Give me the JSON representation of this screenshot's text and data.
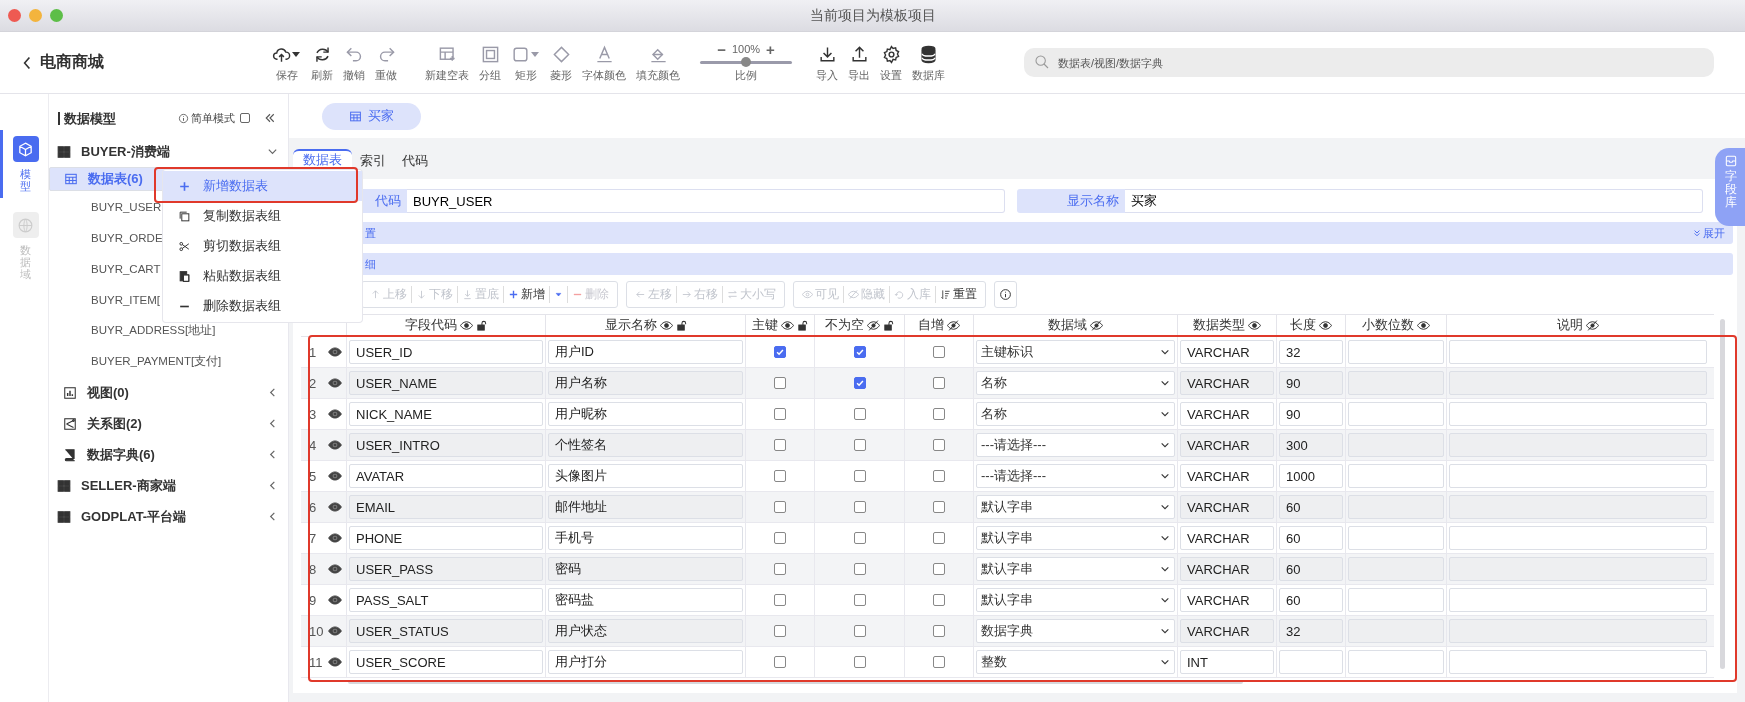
{
  "window": {
    "title": "当前项目为模板项目"
  },
  "header": {
    "back_label": "电商商城"
  },
  "toolbar": [
    {
      "label": "保存",
      "disabled": false,
      "dropdown": true
    },
    {
      "label": "刷新",
      "disabled": false,
      "dropdown": false
    },
    {
      "label": "撤销",
      "disabled": true,
      "dropdown": false
    },
    {
      "label": "重做",
      "disabled": true,
      "dropdown": false
    },
    {
      "label": "新建空表",
      "disabled": true,
      "dropdown": false
    },
    {
      "label": "分组",
      "disabled": true,
      "dropdown": false
    },
    {
      "label": "矩形",
      "disabled": true,
      "dropdown": true
    },
    {
      "label": "菱形",
      "disabled": true,
      "dropdown": false
    },
    {
      "label": "字体颜色",
      "disabled": true,
      "dropdown": false
    },
    {
      "label": "填充颜色",
      "disabled": true,
      "dropdown": false
    }
  ],
  "zoom": {
    "decrease": "−",
    "value": "100%",
    "increase": "+",
    "level": 0.5,
    "label": "比例"
  },
  "toolbar_right": [
    {
      "label": "导入"
    },
    {
      "label": "导出"
    },
    {
      "label": "设置"
    },
    {
      "label": "数据库"
    }
  ],
  "search": {
    "placeholder": "数据表/视图/数据字典"
  },
  "rail": [
    {
      "label": "模型",
      "selected": true
    },
    {
      "label": "数据域",
      "selected": false
    }
  ],
  "sidebar": {
    "title": "数据模型",
    "simple_mode": {
      "label": "简单模式",
      "checked": false
    },
    "tree": [
      {
        "label": "BUYER-消费端",
        "kind": "group",
        "expanded": true,
        "selected": false,
        "children": [
          {
            "label": "数据表(6)",
            "kind": "tables",
            "expanded": true,
            "selected": true,
            "children": [
              {
                "label": "BUYR_USER",
                "kind": "table",
                "selected": false
              },
              {
                "label": "BUYR_ORDE",
                "kind": "table",
                "selected": false
              },
              {
                "label": "BUYR_CART",
                "kind": "table",
                "selected": false
              },
              {
                "label": "BUYR_ITEM[",
                "kind": "table",
                "selected": false
              },
              {
                "label": "BUYR_ADDRESS[地址]",
                "kind": "table",
                "selected": false
              },
              {
                "label": "BUYER_PAYMENT[支付]",
                "kind": "table",
                "selected": false
              }
            ]
          },
          {
            "label": "视图(0)",
            "kind": "views",
            "expanded": false,
            "selected": false
          },
          {
            "label": "关系图(2)",
            "kind": "diagram",
            "expanded": false,
            "selected": false
          },
          {
            "label": "数据字典(6)",
            "kind": "dictionary",
            "expanded": false,
            "selected": false
          }
        ]
      },
      {
        "label": "SELLER-商家端",
        "kind": "group",
        "expanded": false,
        "selected": false
      },
      {
        "label": "GODPLAT-平台端",
        "kind": "group",
        "expanded": false,
        "selected": false
      }
    ]
  },
  "context_menu": [
    {
      "label": "新增数据表",
      "selected": true
    },
    {
      "label": "复制数据表组",
      "selected": false
    },
    {
      "label": "剪切数据表组",
      "selected": false
    },
    {
      "label": "粘贴数据表组",
      "selected": false
    },
    {
      "label": "删除数据表组",
      "selected": false
    }
  ],
  "doc_tabs": [
    {
      "label": "买家",
      "selected": true
    }
  ],
  "side_tab": {
    "label": "字段库"
  },
  "panel_tabs": [
    {
      "label": "数据表",
      "selected": true
    },
    {
      "label": "索引",
      "selected": false
    },
    {
      "label": "代码",
      "selected": false
    }
  ],
  "form": [
    {
      "label": "代码",
      "value": "BUYR_USER"
    },
    {
      "label": "显示名称",
      "value": "买家"
    }
  ],
  "sections": [
    {
      "label": "置",
      "toggle": "展开"
    },
    {
      "label": "细"
    }
  ],
  "table_toolbar": [
    [
      {
        "kind": "button",
        "label": "上移",
        "disabled": true
      },
      {
        "kind": "button",
        "label": "下移",
        "disabled": true
      },
      {
        "kind": "button",
        "label": "置底",
        "disabled": true
      },
      {
        "kind": "button",
        "label": "新增",
        "disabled": false
      },
      {
        "kind": "caret",
        "disabled": false
      },
      {
        "kind": "button",
        "label": "删除",
        "disabled": true
      }
    ],
    [
      {
        "kind": "button",
        "label": "左移",
        "disabled": true
      },
      {
        "kind": "button",
        "label": "右移",
        "disabled": true
      },
      {
        "kind": "button",
        "label": "大小写",
        "disabled": true
      }
    ],
    [
      {
        "kind": "button",
        "label": "可见",
        "disabled": true
      },
      {
        "kind": "button",
        "label": "隐藏",
        "disabled": true
      },
      {
        "kind": "button",
        "label": "入库",
        "disabled": true
      },
      {
        "kind": "button",
        "label": "重置",
        "disabled": false
      }
    ],
    [
      {
        "kind": "info",
        "disabled": false
      }
    ]
  ],
  "table": {
    "columns": [
      {
        "label": "字段代码",
        "visible": true,
        "lock": true
      },
      {
        "label": "显示名称",
        "visible": true,
        "lock": true
      },
      {
        "label": "主键",
        "visible": true,
        "lock": true
      },
      {
        "label": "不为空",
        "visible": false,
        "lock": true
      },
      {
        "label": "自增",
        "visible": false,
        "lock": false
      },
      {
        "label": "数据域",
        "visible": false,
        "lock": false
      },
      {
        "label": "数据类型",
        "visible": true,
        "lock": false
      },
      {
        "label": "长度",
        "visible": true,
        "lock": false
      },
      {
        "label": "小数位数",
        "visible": true,
        "lock": false
      },
      {
        "label": "说明",
        "visible": false,
        "lock": false
      }
    ],
    "rows": [
      {
        "number": "1",
        "visible": true,
        "code": "USER_ID",
        "name": "用户ID",
        "primary_key": true,
        "not_null": true,
        "auto_increment": false,
        "domain": "主键标识",
        "type": "VARCHAR",
        "length": "32"
      },
      {
        "number": "2",
        "visible": true,
        "code": "USER_NAME",
        "name": "用户名称",
        "primary_key": false,
        "not_null": true,
        "auto_increment": false,
        "domain": "名称",
        "type": "VARCHAR",
        "length": "90"
      },
      {
        "number": "3",
        "visible": true,
        "code": "NICK_NAME",
        "name": "用户昵称",
        "primary_key": false,
        "not_null": false,
        "auto_increment": false,
        "domain": "名称",
        "type": "VARCHAR",
        "length": "90"
      },
      {
        "number": "4",
        "visible": true,
        "code": "USER_INTRO",
        "name": "个性签名",
        "primary_key": false,
        "not_null": false,
        "auto_increment": false,
        "domain": "---请选择---",
        "type": "VARCHAR",
        "length": "300"
      },
      {
        "number": "5",
        "visible": true,
        "code": "AVATAR",
        "name": "头像图片",
        "primary_key": false,
        "not_null": false,
        "auto_increment": false,
        "domain": "---请选择---",
        "type": "VARCHAR",
        "length": "1000"
      },
      {
        "number": "6",
        "visible": true,
        "code": "EMAIL",
        "name": "邮件地址",
        "primary_key": false,
        "not_null": false,
        "auto_increment": false,
        "domain": "默认字串",
        "type": "VARCHAR",
        "length": "60"
      },
      {
        "number": "7",
        "visible": true,
        "code": "PHONE",
        "name": "手机号",
        "primary_key": false,
        "not_null": false,
        "auto_increment": false,
        "domain": "默认字串",
        "type": "VARCHAR",
        "length": "60"
      },
      {
        "number": "8",
        "visible": true,
        "code": "USER_PASS",
        "name": "密码",
        "primary_key": false,
        "not_null": false,
        "auto_increment": false,
        "domain": "默认字串",
        "type": "VARCHAR",
        "length": "60"
      },
      {
        "number": "9",
        "visible": true,
        "code": "PASS_SALT",
        "name": "密码盐",
        "primary_key": false,
        "not_null": false,
        "auto_increment": false,
        "domain": "默认字串",
        "type": "VARCHAR",
        "length": "60"
      },
      {
        "number": "10",
        "visible": true,
        "code": "USER_STATUS",
        "name": "用户状态",
        "primary_key": false,
        "not_null": false,
        "auto_increment": false,
        "domain": "数据字典",
        "type": "VARCHAR",
        "length": "32"
      },
      {
        "number": "11",
        "visible": true,
        "code": "USER_SCORE",
        "name": "用户打分",
        "primary_key": false,
        "not_null": false,
        "auto_increment": false,
        "domain": "整数",
        "type": "INT"
      }
    ]
  }
}
